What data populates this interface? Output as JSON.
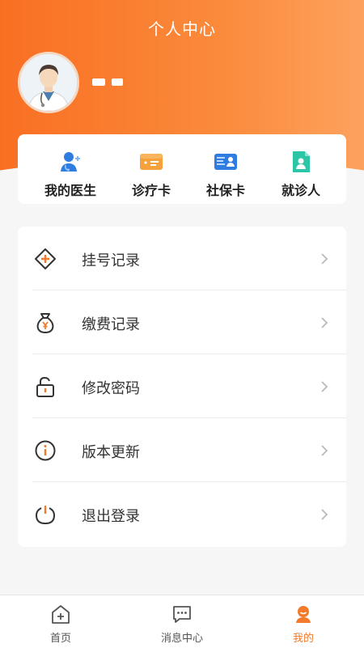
{
  "header": {
    "title": "个人中心"
  },
  "quick_actions": [
    {
      "label": "我的医生",
      "icon": "doctor-icon"
    },
    {
      "label": "诊疗卡",
      "icon": "medical-card-icon"
    },
    {
      "label": "社保卡",
      "icon": "social-security-card-icon"
    },
    {
      "label": "就诊人",
      "icon": "patient-icon"
    }
  ],
  "menu": [
    {
      "label": "挂号记录",
      "icon": "registration-icon"
    },
    {
      "label": "缴费记录",
      "icon": "payment-bag-icon"
    },
    {
      "label": "修改密码",
      "icon": "lock-icon"
    },
    {
      "label": "版本更新",
      "icon": "info-icon"
    },
    {
      "label": "退出登录",
      "icon": "power-icon"
    }
  ],
  "tabbar": [
    {
      "label": "首页",
      "icon": "home-icon"
    },
    {
      "label": "消息中心",
      "icon": "message-icon"
    },
    {
      "label": "我的",
      "icon": "profile-icon",
      "active": true
    }
  ],
  "colors": {
    "accent": "#f27a2a",
    "header_gradient_start": "#f96f22",
    "header_gradient_end": "#fca25e"
  }
}
